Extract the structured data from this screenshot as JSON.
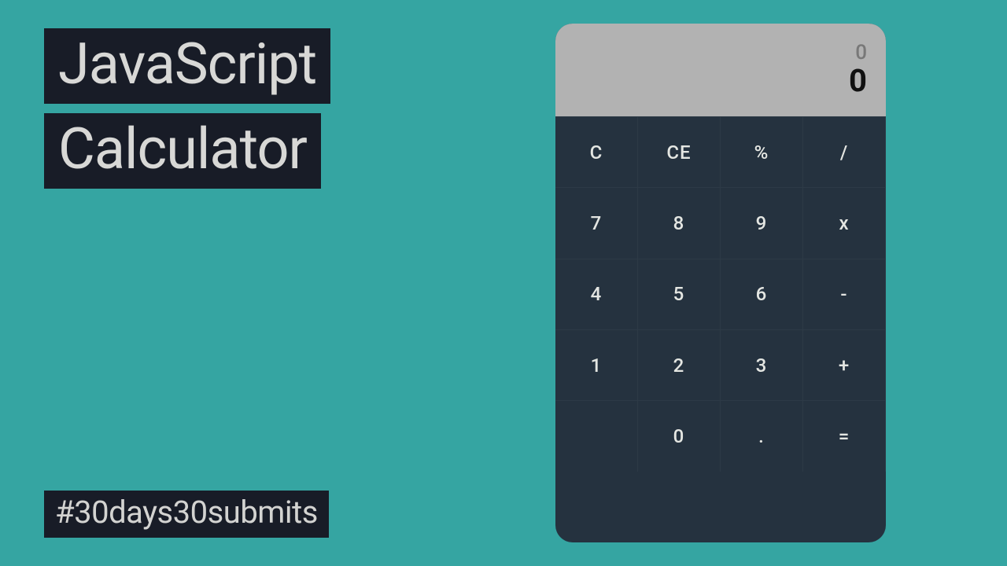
{
  "title": {
    "line1": "JavaScript",
    "line2": "Calculator"
  },
  "hashtag": "#30days30submits",
  "calculator": {
    "display": {
      "previous": "0",
      "current": "0"
    },
    "keys": [
      {
        "name": "clear-key",
        "label": "C",
        "interactable": true
      },
      {
        "name": "clear-entry-key",
        "label": "CE",
        "interactable": true
      },
      {
        "name": "percent-key",
        "label": "%",
        "interactable": true
      },
      {
        "name": "divide-key",
        "label": "/",
        "interactable": true
      },
      {
        "name": "seven-key",
        "label": "7",
        "interactable": true
      },
      {
        "name": "eight-key",
        "label": "8",
        "interactable": true
      },
      {
        "name": "nine-key",
        "label": "9",
        "interactable": true
      },
      {
        "name": "multiply-key",
        "label": "x",
        "interactable": true
      },
      {
        "name": "four-key",
        "label": "4",
        "interactable": true
      },
      {
        "name": "five-key",
        "label": "5",
        "interactable": true
      },
      {
        "name": "six-key",
        "label": "6",
        "interactable": true
      },
      {
        "name": "subtract-key",
        "label": "-",
        "interactable": true
      },
      {
        "name": "one-key",
        "label": "1",
        "interactable": true
      },
      {
        "name": "two-key",
        "label": "2",
        "interactable": true
      },
      {
        "name": "three-key",
        "label": "3",
        "interactable": true
      },
      {
        "name": "add-key",
        "label": "+",
        "interactable": true
      },
      {
        "name": "blank-key",
        "label": "",
        "interactable": false
      },
      {
        "name": "zero-key",
        "label": "0",
        "interactable": true
      },
      {
        "name": "decimal-key",
        "label": ".",
        "interactable": true
      },
      {
        "name": "equals-key",
        "label": "=",
        "interactable": true
      }
    ]
  }
}
